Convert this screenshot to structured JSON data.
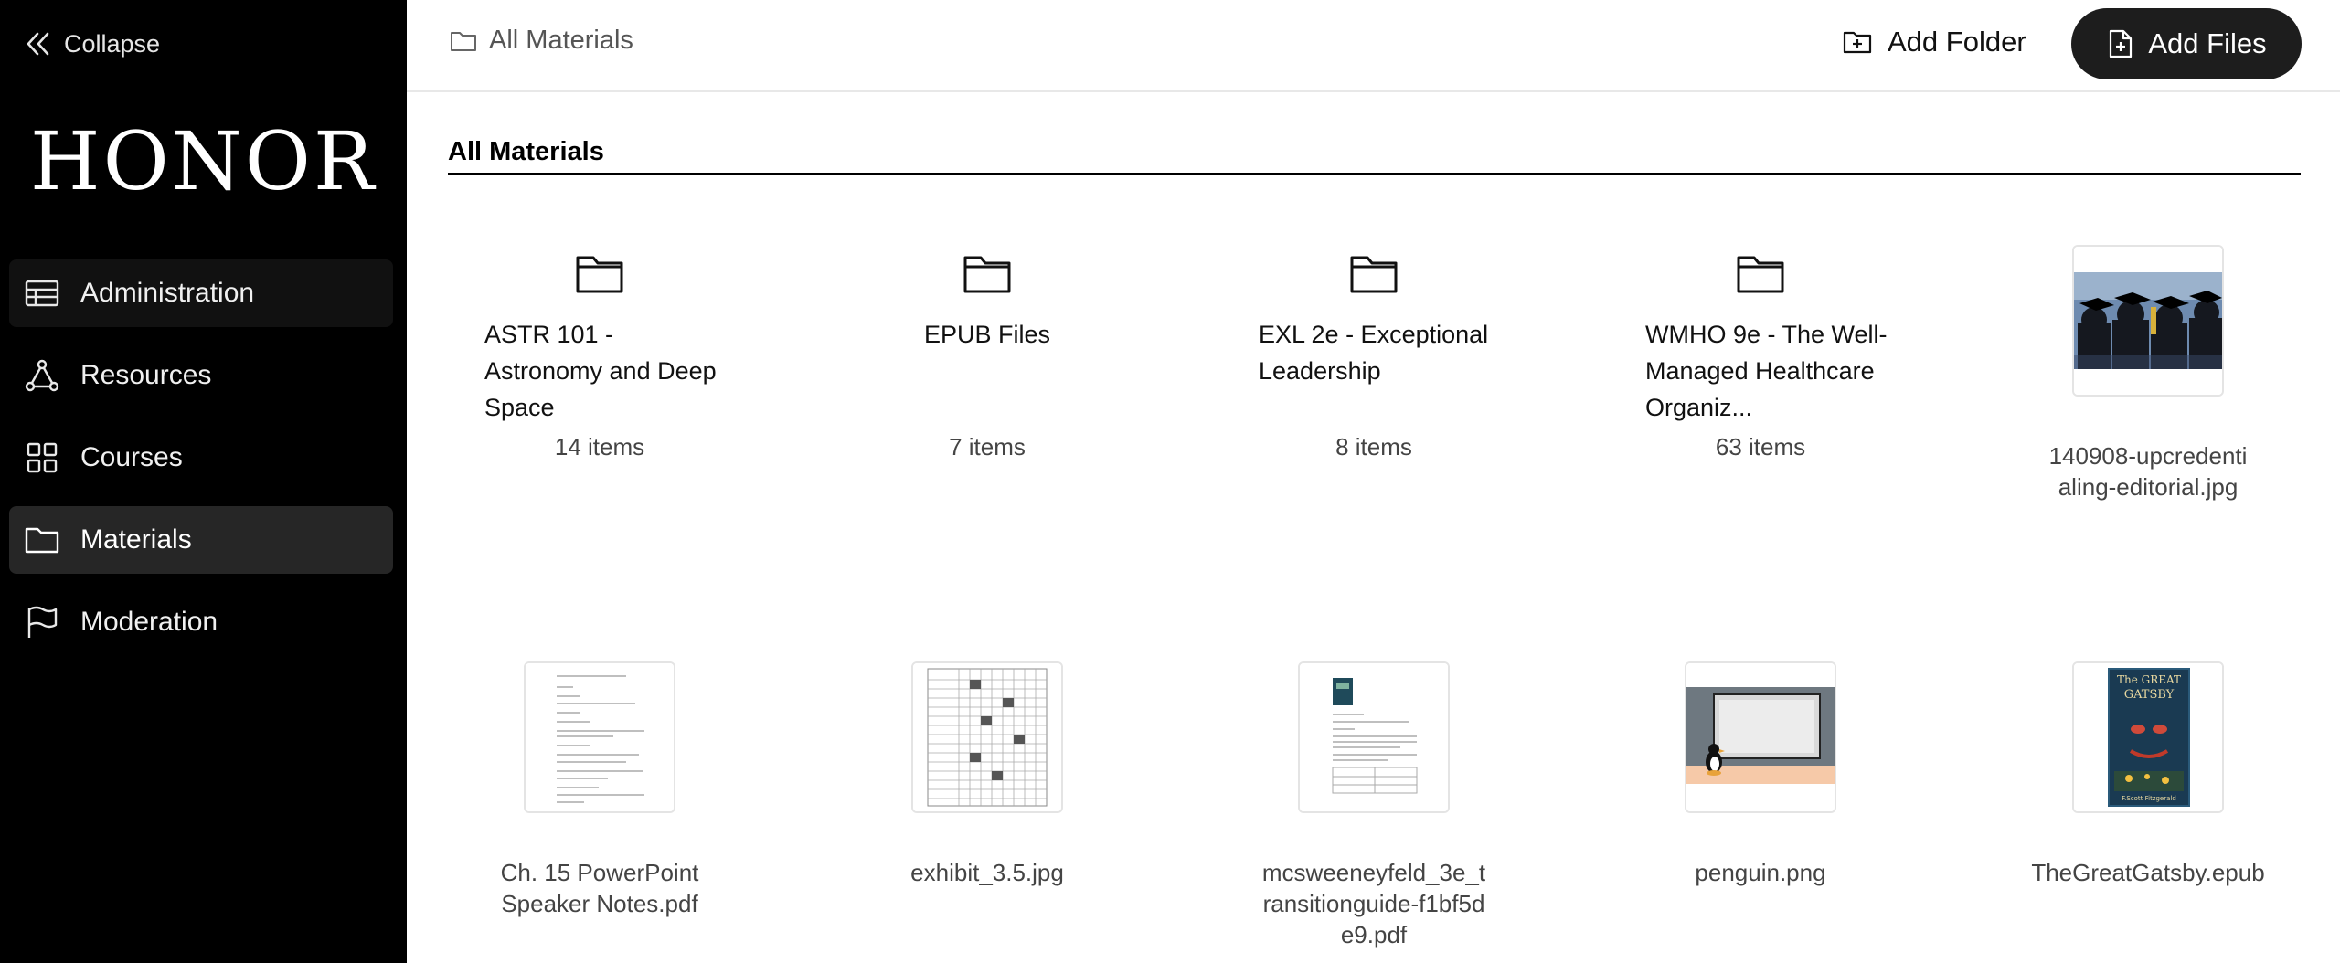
{
  "sidebar": {
    "collapse_label": "Collapse",
    "brand": "HONOR",
    "items": [
      {
        "label": "Administration",
        "icon": "table-icon"
      },
      {
        "label": "Resources",
        "icon": "network-icon"
      },
      {
        "label": "Courses",
        "icon": "grid-icon"
      },
      {
        "label": "Materials",
        "icon": "folder-icon",
        "active": true
      },
      {
        "label": "Moderation",
        "icon": "flag-icon"
      }
    ]
  },
  "header": {
    "breadcrumb": "All Materials",
    "add_folder_label": "Add Folder",
    "add_files_label": "Add Files"
  },
  "main": {
    "title": "All Materials",
    "folders": [
      {
        "name": "ASTR 101 - Astronomy and Deep Space",
        "count": "14 items"
      },
      {
        "name": "EPUB Files",
        "count": "7 items"
      },
      {
        "name": "EXL 2e - Exceptional Leadership",
        "count": "8 items"
      },
      {
        "name": "WMHO 9e - The Well-Managed Healthcare Organiz...",
        "count": "63 items"
      }
    ],
    "files": [
      {
        "name": "140908-upcredentialing-editorial.jpg"
      },
      {
        "name": "Ch. 15 PowerPoint Speaker Notes.pdf"
      },
      {
        "name": "exhibit_3.5.jpg"
      },
      {
        "name": "mcsweeneyfeld_3e_transitionguide-f1bf5de9.pdf"
      },
      {
        "name": "penguin.png"
      },
      {
        "name": "TheGreatGatsby.epub"
      }
    ],
    "gatsby_cover": {
      "title_line1": "The GREAT",
      "title_line2": "GATSBY",
      "author": "F.Scott Fitzgerald"
    }
  }
}
